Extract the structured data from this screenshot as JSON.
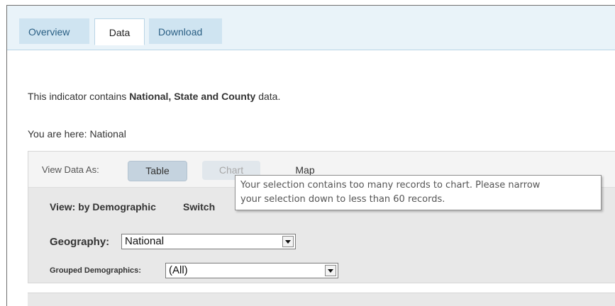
{
  "tabs": [
    {
      "label": "Overview",
      "active": false
    },
    {
      "label": "Data",
      "active": true
    },
    {
      "label": "Download",
      "active": false
    }
  ],
  "indicator": {
    "prefix": "This indicator contains ",
    "levels": "National, State and County",
    "suffix": " data."
  },
  "breadcrumb": "You are here: National",
  "view_bar": {
    "label": "View Data As:",
    "buttons": [
      {
        "label": "Table",
        "state": "selected"
      },
      {
        "label": "Chart",
        "state": "disabled"
      },
      {
        "label": "Map",
        "state": "enabled"
      }
    ]
  },
  "controls": {
    "view_by": "View: by Demographic",
    "switch_label": "Switch",
    "geography": {
      "label": "Geography:",
      "value": "National"
    },
    "grouped": {
      "label": "Grouped Demographics:",
      "value": "(All)"
    }
  },
  "tooltip": {
    "line1": "Your selection contains too many records to chart. Please narrow",
    "line2": "your selection down to less than 60 records."
  },
  "colors": {
    "tab_strip": "#e9f3f9",
    "tab_inactive": "#cfe4f1",
    "panel": "#e8e8e8",
    "selected_button": "#c5d3df"
  },
  "icons": [
    "dropdown-arrow-icon"
  ]
}
